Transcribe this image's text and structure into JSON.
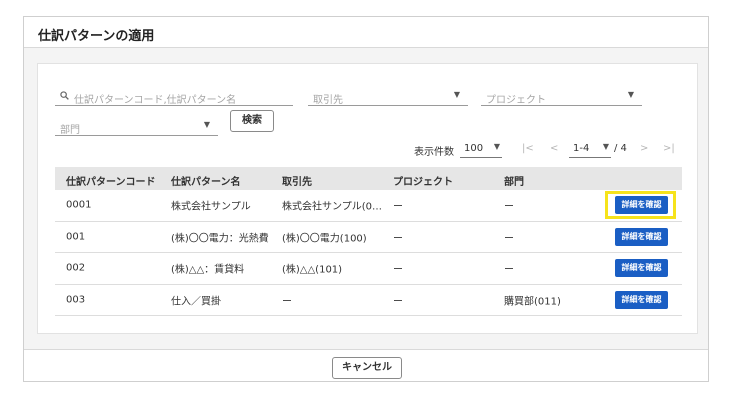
{
  "dialog": {
    "title": "仕訳パターンの適用",
    "cancel_label": "キャンセル"
  },
  "filters": {
    "search_placeholder": "仕訳パターンコード,仕訳パターン名",
    "partner_placeholder": "取引先",
    "project_placeholder": "プロジェクト",
    "department_placeholder": "部門",
    "search_button": "検索"
  },
  "pager": {
    "per_page_label": "表示件数",
    "per_page_value": "100",
    "range": "1-4",
    "total": "/ 4",
    "first_icon": "|<",
    "prev_icon": "<",
    "next_icon": ">",
    "last_icon": ">|"
  },
  "table": {
    "headers": [
      "仕訳パターンコード",
      "仕訳パターン名",
      "取引先",
      "プロジェクト",
      "部門"
    ],
    "detail_label": "詳細を確認",
    "rows": [
      {
        "code": "0001",
        "name": "株式会社サンプル",
        "partner": "株式会社サンプル(0…",
        "project": "ー",
        "department": "ー"
      },
      {
        "code": "001",
        "name": "(株)〇〇電力：光熱費",
        "partner": "(株)〇〇電力(100)",
        "project": "ー",
        "department": "ー"
      },
      {
        "code": "002",
        "name": "(株)△△：賃貸料",
        "partner": "(株)△△(101)",
        "project": "ー",
        "department": "ー"
      },
      {
        "code": "003",
        "name": "仕入／買掛",
        "partner": "ー",
        "project": "ー",
        "department": "購買部(011)"
      }
    ]
  },
  "colors": {
    "accent": "#1a5ec4",
    "highlight": "#f6e31b"
  }
}
